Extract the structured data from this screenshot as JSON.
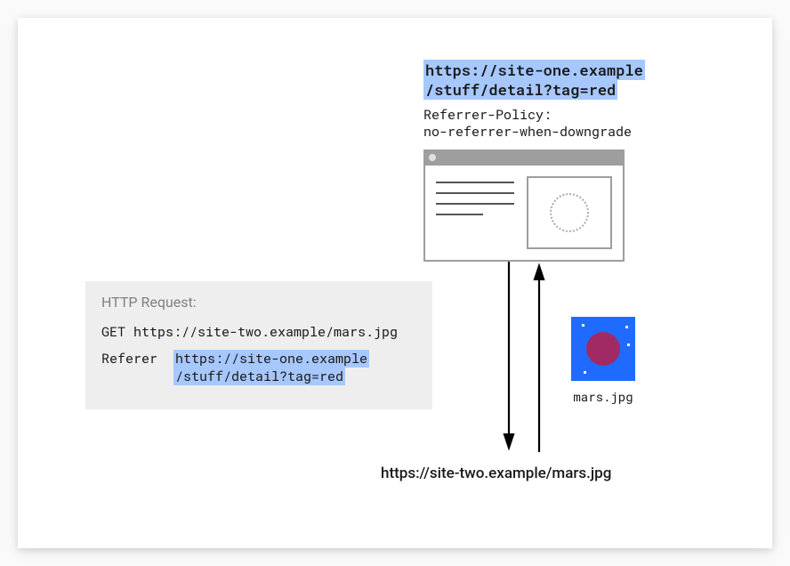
{
  "site_url": {
    "line1": "https://site-one.example",
    "line2": "/stuff/detail?tag=red"
  },
  "referrer_policy": {
    "header": "Referrer-Policy:",
    "value": "no-referrer-when-downgrade"
  },
  "http_request": {
    "title": "HTTP Request:",
    "method_line": "GET https://site-two.example/mars.jpg",
    "referer_label": "Referer",
    "referer_value_line1": "https://site-one.example",
    "referer_value_line2": "/stuff/detail?tag=red"
  },
  "image": {
    "filename": "mars.jpg"
  },
  "target_url": "https://site-two.example/mars.jpg"
}
